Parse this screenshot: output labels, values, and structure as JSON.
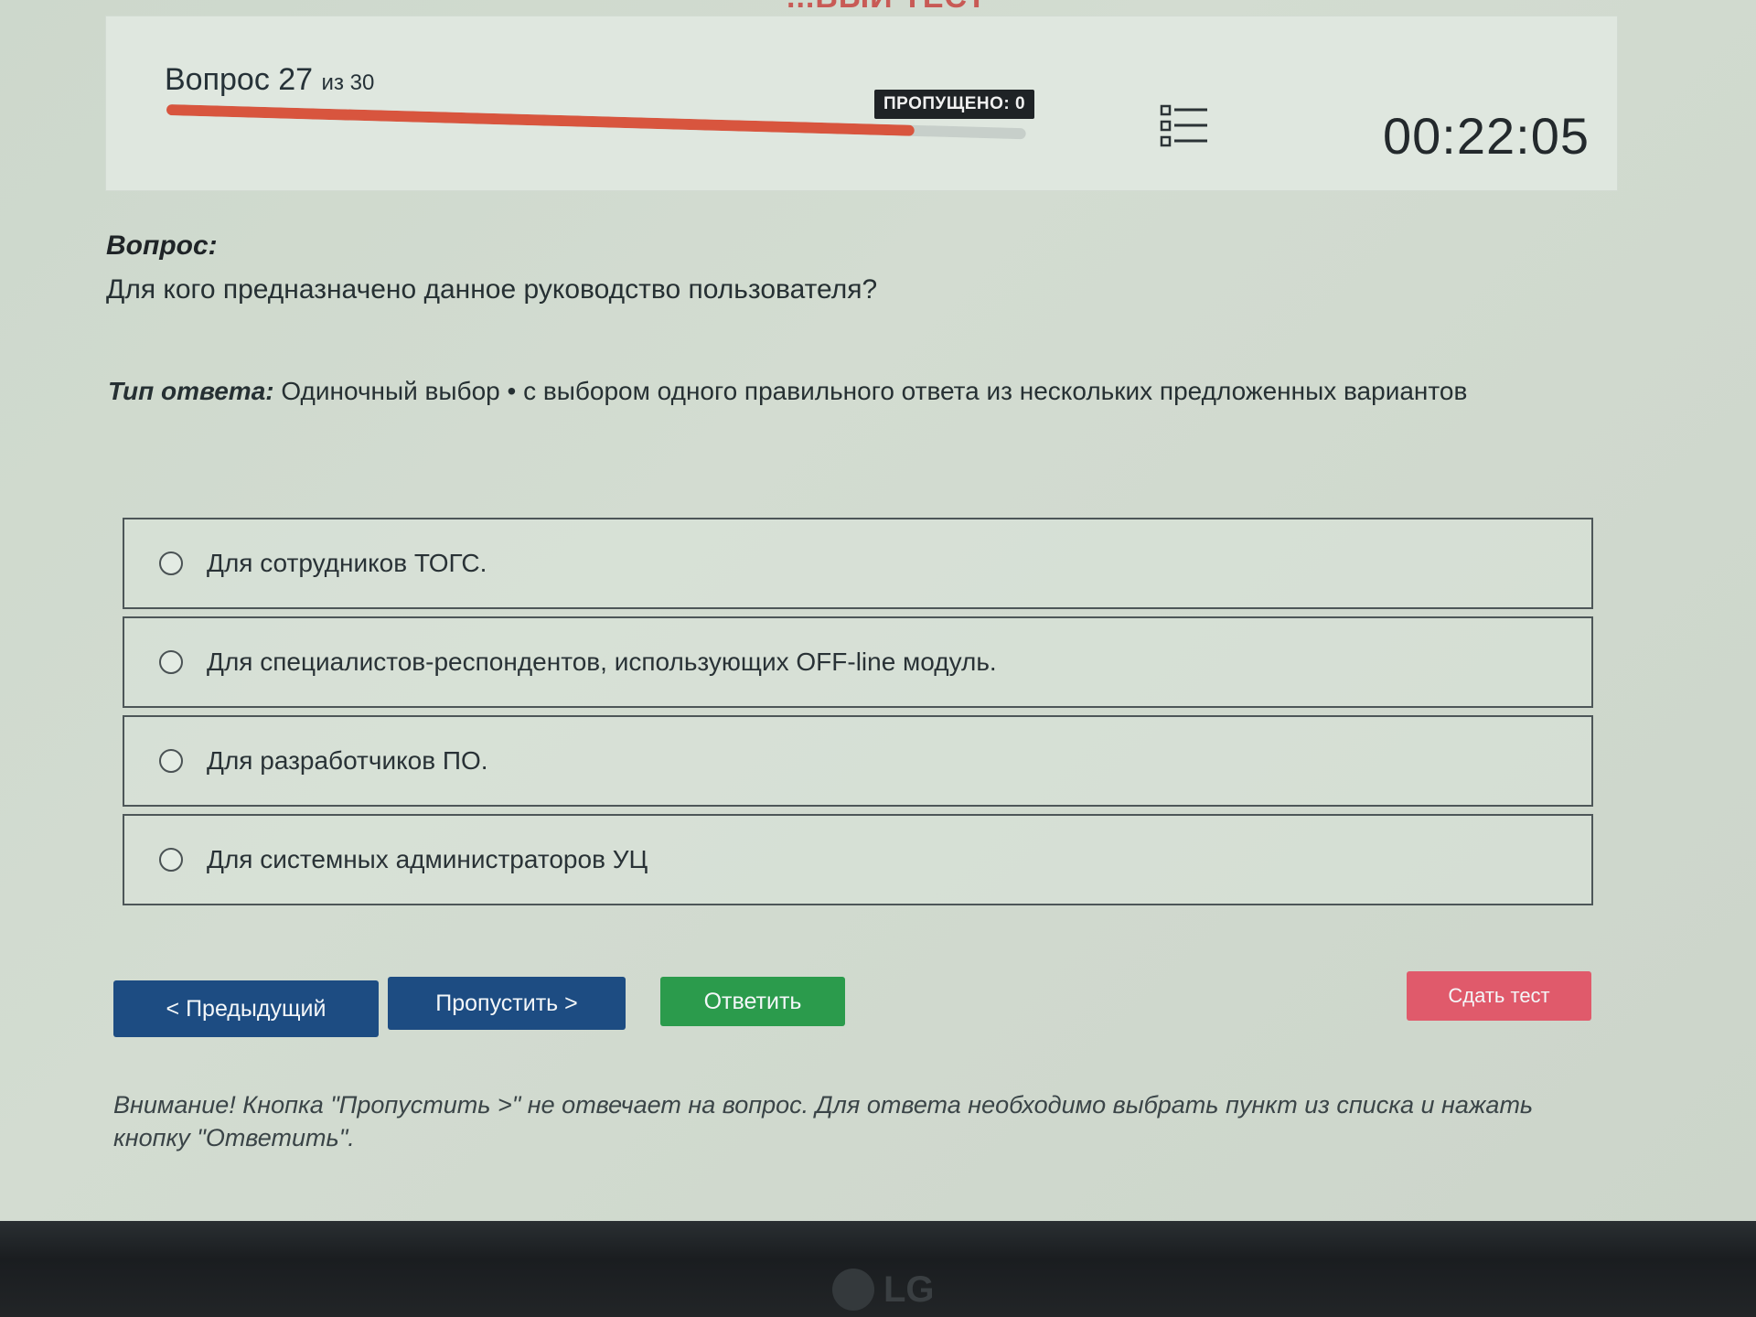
{
  "page": {
    "top_partial_title": "...ВЫЙ ТЕСТ"
  },
  "header": {
    "question_word": "Вопрос 27",
    "question_of": "из 30",
    "progress_fraction": 0.87,
    "skipped_badge": "ПРОПУЩЕНО: 0",
    "list_icon": "question-list-icon",
    "timer": "00:22:05"
  },
  "question": {
    "label": "Вопрос:",
    "text": "Для кого предназначено данное руководство пользователя?"
  },
  "answer_type": {
    "label": "Тип ответа:",
    "value": "Одиночный выбор • с выбором одного правильного ответа из нескольких предложенных вариантов"
  },
  "options": [
    {
      "text": "Для сотрудников ТОГС."
    },
    {
      "text": "Для специалистов-респондентов, использующих OFF-line модуль."
    },
    {
      "text": "Для разработчиков ПО."
    },
    {
      "text": "Для системных администраторов УЦ"
    }
  ],
  "buttons": {
    "prev": "< Предыдущий",
    "skip": "Пропустить >",
    "answer": "Ответить",
    "submit": "Сдать тест"
  },
  "colors": {
    "primary_button": "#1d4c82",
    "answer_button": "#2b9b4c",
    "submit_button": "#e05a6b",
    "progress": "#d8553e"
  },
  "warning": "Внимание! Кнопка \"Пропустить >\" не отвечает на вопрос. Для ответа необходимо выбрать пункт из списка и нажать кнопку \"Ответить\".",
  "bezel": {
    "brand": "LG"
  }
}
